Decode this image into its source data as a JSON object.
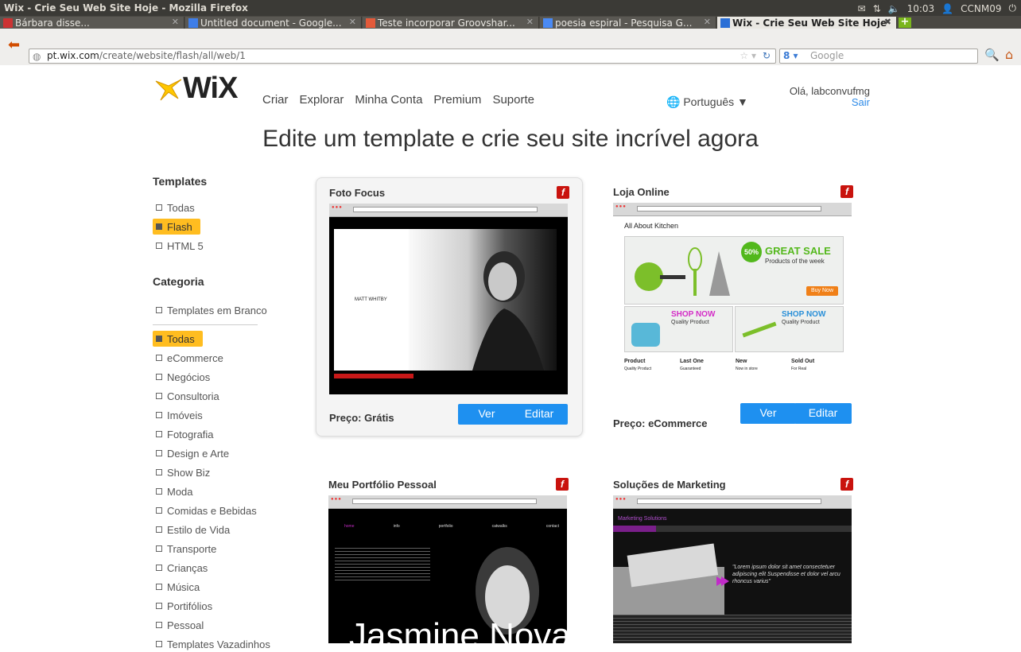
{
  "window_title": "Wix - Crie Seu Web Site Hoje - Mozilla Firefox",
  "tray": {
    "time": "10:03",
    "user": "CCNM09"
  },
  "tabs": [
    {
      "label": "Bárbara disse..."
    },
    {
      "label": "Untitled document - Google..."
    },
    {
      "label": "Teste incorporar Groovshar..."
    },
    {
      "label": "poesia espiral - Pesquisa G..."
    },
    {
      "label": "Wix - Crie Seu Web Site Hoje"
    }
  ],
  "url": {
    "domain": "pt.wix.com",
    "path": "/create/website/flash/all/web/1"
  },
  "search": {
    "placeholder": "Google"
  },
  "site": {
    "logo": "WiX",
    "nav": [
      "Criar",
      "Explorar",
      "Minha Conta",
      "Premium",
      "Suporte"
    ],
    "language": "Português ▼",
    "greeting": "Olá, labconvufmg",
    "logout": "Sair",
    "headline": "Edite um template e crie seu site incrível agora"
  },
  "sidebar": {
    "templates_title": "Templates",
    "templates": [
      "Todas",
      "Flash",
      "HTML 5"
    ],
    "categoria_title": "Categoria",
    "blank": "Templates em Branco",
    "categories": [
      "Todas",
      "eCommerce",
      "Negócios",
      "Consultoria",
      "Imóveis",
      "Fotografia",
      "Design e Arte",
      "Show Biz",
      "Moda",
      "Comidas e Bebidas",
      "Estilo de Vida",
      "Transporte",
      "Crianças",
      "Música",
      "Portifólios",
      "Pessoal",
      "Templates Vazadinhos"
    ]
  },
  "cards": [
    {
      "title": "Foto Focus",
      "price": "Preço: Grátis",
      "thumb_text": "MATT WHITBY"
    },
    {
      "title": "Loja Online",
      "price": "Preço: eCommerce",
      "thumb_text": "All About Kitchen",
      "sale": "GREAT SALE",
      "sale_sub": "Products of the week",
      "shop": "SHOP NOW",
      "shop_sub": "Quality Product",
      "buy": "Buy Now",
      "badge": "50%",
      "row": [
        "Product",
        "Last One",
        "New",
        "Sold Out"
      ],
      "row_sub": [
        "Quality Product",
        "Guaranteed",
        "Now in store",
        "For Real"
      ]
    },
    {
      "title": "Meu Portfólio Pessoal",
      "thumb_text": "Jasmine Nova",
      "nav": [
        "home",
        "info",
        "portfolio",
        "catwalks",
        "contact"
      ]
    },
    {
      "title": "Soluções de Marketing",
      "thumb_text": "Marketing Solutions",
      "quote": "\"Lorem ipsum dolor sit amet consectetuer adipiscing elit Suspendisse et dolor vel arcu rhoncus varius\""
    }
  ],
  "buttons": {
    "ver": "Ver",
    "editar": "Editar"
  },
  "colors": {
    "accent": "#1e90f0",
    "selected": "#ffbd20",
    "flash": "#c9130e"
  }
}
